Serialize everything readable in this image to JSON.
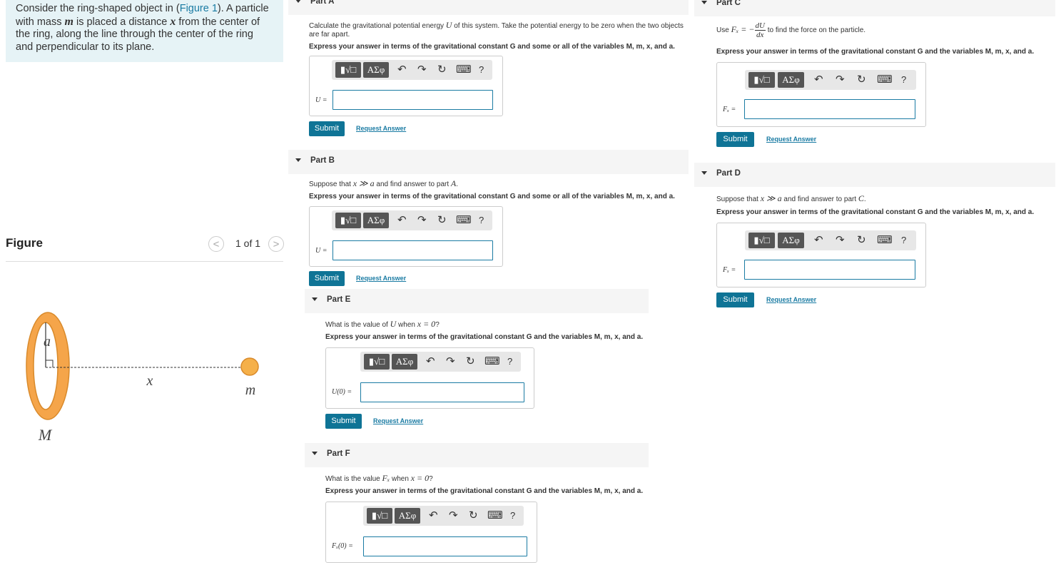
{
  "intro": {
    "t1": "Consider the ring-shaped object in (",
    "fig_link": "Figure 1",
    "t2": "). A particle with mass ",
    "m": "m",
    "t3": " is placed a distance ",
    "x": "x",
    "t4": " from the center of the ring, along the line through the center of the ring and perpendicular to its plane."
  },
  "figure": {
    "title": "Figure",
    "pager": "1 of 1",
    "prev_glyph": "<",
    "next_glyph": ">",
    "label_a": "a",
    "label_x": "x",
    "label_m": "m",
    "label_M": "M",
    "colors": {
      "ring_fill": "#f5a54a",
      "ring_edge": "#d98a2b",
      "particle": "#f5b04a"
    }
  },
  "toolbar": {
    "templates_glyph": "▮√□",
    "greek_label": "ΑΣφ",
    "undo": "↶",
    "redo": "↷",
    "reset": "↻",
    "keyboard": "⌨",
    "help": "?"
  },
  "common": {
    "submit": "Submit",
    "request": "Request Answer"
  },
  "parts": {
    "a": {
      "label": "Part A",
      "q1": "Calculate the gravitational potential energy ",
      "q_var": "U",
      "q2": " of this system. Take the potential energy to be zero when the two objects are far apart.",
      "inst": "Express your answer in terms of the gravitational constant G and some or all of the variables M, m, x, and a.",
      "input_label": "U ="
    },
    "b": {
      "label": "Part B",
      "q1": "Suppose that ",
      "q_math": "x ≫ a",
      "q2": " and find answer to part ",
      "q_ref": "A",
      "q3": ".",
      "inst": "Express your answer in terms of the gravitational constant G and some or all of the variables M, m, x, and a.",
      "input_label": "U ="
    },
    "c": {
      "label": "Part C",
      "q1": "Use ",
      "q_lhs": "Fₓ = −",
      "q_num": "dU",
      "q_den": "dx",
      "q2": " to find the force on the particle.",
      "inst": "Express your answer in terms of the gravitational constant G and the variables M, m, x, and a.",
      "input_label": "Fₓ ="
    },
    "d": {
      "label": "Part D",
      "q1": "Suppose that ",
      "q_math": "x ≫ a",
      "q2": " and find answer to part ",
      "q_ref": "C",
      "q3": ".",
      "inst": "Express your answer in terms of the gravitational constant G and the variables M, m, x, and a.",
      "input_label": "Fₓ ="
    },
    "e": {
      "label": "Part E",
      "q1": "What is the value of ",
      "q_var": "U",
      "q2": " when ",
      "q_math": "x = 0",
      "q3": "?",
      "inst": "Express your answer in terms of the gravitational constant G and the variables M, m, x, and a.",
      "input_label": "U(0) ="
    },
    "f": {
      "label": "Part F",
      "q1": "What is the value ",
      "q_var": "Fₓ",
      "q2": " when ",
      "q_math": "x = 0",
      "q3": "?",
      "inst": "Express your answer in terms of the gravitational constant G and the variables M, m, x, and a.",
      "input_label": "Fₓ(0) ="
    }
  }
}
